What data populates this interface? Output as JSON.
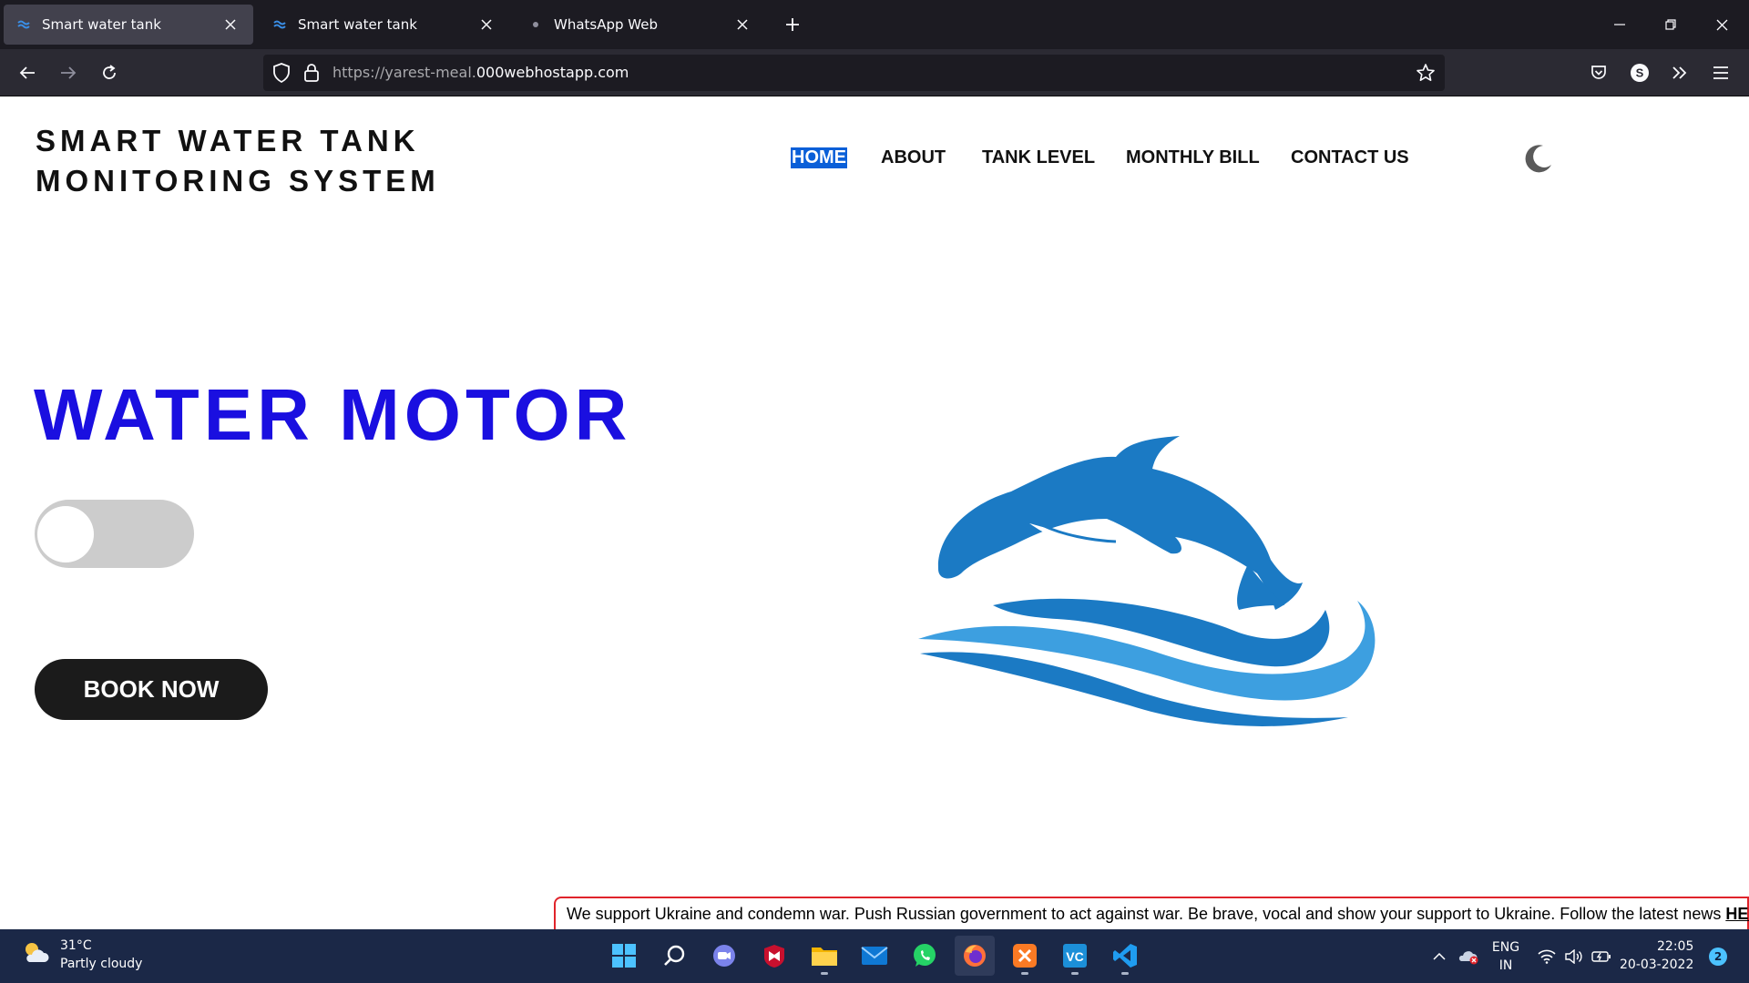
{
  "browser": {
    "tabs": [
      {
        "title": "Smart water tank",
        "icon": "water-favicon-icon",
        "active": true
      },
      {
        "title": "Smart water tank",
        "icon": "water-favicon-icon",
        "active": false
      },
      {
        "title": "WhatsApp Web",
        "icon": "loading-dot-icon",
        "active": false
      }
    ],
    "url_prefix": "https://yarest-meal.",
    "url_domain": "000webhostapp.com",
    "profile_initial": "S"
  },
  "site": {
    "title_line1": "SMART WATER TANK",
    "title_line2": "MONITORING SYSTEM",
    "nav": [
      {
        "label": "HOME",
        "active": true
      },
      {
        "label": "ABOUT",
        "active": false
      },
      {
        "label": "TANK LEVEL",
        "active": false
      },
      {
        "label": "MONTHLY BILL",
        "active": false
      },
      {
        "label": "CONTACT US",
        "active": false
      }
    ],
    "theme_icon": "moon-icon"
  },
  "hero": {
    "heading": "WATER MOTOR",
    "motor_on": false,
    "button_label": "BOOK NOW",
    "logo_icon": "dolphin-waves-logo"
  },
  "banner": {
    "message": "We support Ukraine and condemn war. Push Russian government to act against war. Be brave, vocal and show your support to Ukraine. Follow the latest news ",
    "link_text": "HERE"
  },
  "taskbar": {
    "temperature": "31°C",
    "weather": "Partly cloudy",
    "language_top": "ENG",
    "language_bottom": "IN",
    "time": "22:05",
    "date": "20-03-2022",
    "notification_count": "2"
  },
  "colors": {
    "accent_blue": "#1a0fe0",
    "nav_active_bg": "#0a5fd8",
    "button_dark": "#1b1b1b",
    "toggle_off": "#cccccc",
    "banner_border": "#e0242b"
  }
}
